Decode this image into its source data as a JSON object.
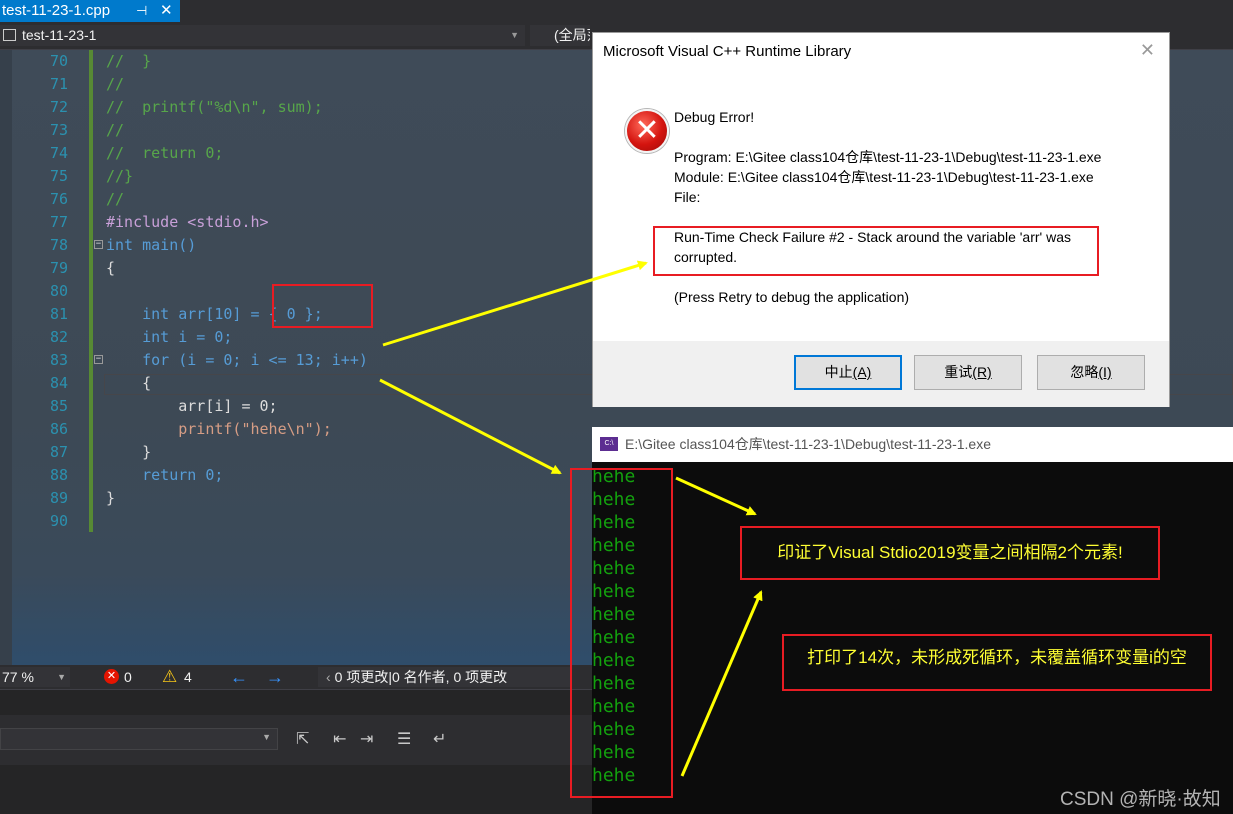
{
  "tab": {
    "title": "test-11-23-1.cpp",
    "pin": "⊣",
    "close": "✕"
  },
  "nav": {
    "project": "test-11-23-1",
    "scope": "(全局范围)"
  },
  "code_lines": [
    {
      "num": "70",
      "text": "//  }"
    },
    {
      "num": "71",
      "text": "//"
    },
    {
      "num": "72",
      "text": "//  printf(\"%d\\n\", sum);"
    },
    {
      "num": "73",
      "text": "//"
    },
    {
      "num": "74",
      "text": "//  return 0;"
    },
    {
      "num": "75",
      "text": "//}"
    },
    {
      "num": "76",
      "text": "//"
    },
    {
      "num": "77",
      "text": "#include <stdio.h>"
    },
    {
      "num": "78",
      "text": "int main()"
    },
    {
      "num": "79",
      "text": "{"
    },
    {
      "num": "80",
      "text": ""
    },
    {
      "num": "81",
      "text": "    int arr[10] = { 0 };"
    },
    {
      "num": "82",
      "text": "    int i = 0;"
    },
    {
      "num": "83",
      "text": "    for (i = 0; i <= 13; i++)"
    },
    {
      "num": "84",
      "text": "    {"
    },
    {
      "num": "85",
      "text": "        arr[i] = 0;"
    },
    {
      "num": "86",
      "text": "        printf(\"hehe\\n\");"
    },
    {
      "num": "87",
      "text": "    }"
    },
    {
      "num": "88",
      "text": "    return 0;"
    },
    {
      "num": "89",
      "text": "}"
    },
    {
      "num": "90",
      "text": ""
    }
  ],
  "status": {
    "zoom": "77 %",
    "errors": "0",
    "warnings": "4",
    "changes": "0 项更改|0 名作者, 0 项更改"
  },
  "dialog": {
    "title": "Microsoft Visual C++ Runtime Library",
    "heading": "Debug Error!",
    "program": "Program: E:\\Gitee class104仓库\\test-11-23-1\\Debug\\test-11-23-1.exe",
    "module": "Module: E:\\Gitee class104仓库\\test-11-23-1\\Debug\\test-11-23-1.exe",
    "file": "File:",
    "failure_line1": "Run-Time Check Failure #2 - Stack around the variable 'arr' was",
    "failure_line2": "corrupted.",
    "hint": "(Press Retry to debug the application)",
    "buttons": {
      "abort": "中止",
      "abort_key": "(A)",
      "retry": "重试",
      "retry_key": "(R)",
      "ignore": "忽略",
      "ignore_key": "(I)"
    }
  },
  "console": {
    "title": "E:\\Gitee class104仓库\\test-11-23-1\\Debug\\test-11-23-1.exe",
    "icon_text": "C:\\",
    "lines": [
      "hehe",
      "hehe",
      "hehe",
      "hehe",
      "hehe",
      "hehe",
      "hehe",
      "hehe",
      "hehe",
      "hehe",
      "hehe",
      "hehe",
      "hehe",
      "hehe"
    ]
  },
  "annotations": {
    "note1": "印证了Visual Stdio2019变量之间相隔2个元素!",
    "note2": "打印了14次，未形成死循环，未覆盖循环变量i的空"
  },
  "watermark": "CSDN @新晓·故知",
  "colors": {
    "accent": "#007acc",
    "annotation_red": "#e81c23",
    "arrow_yellow": "#ffff00",
    "console_green": "#13a10e"
  }
}
